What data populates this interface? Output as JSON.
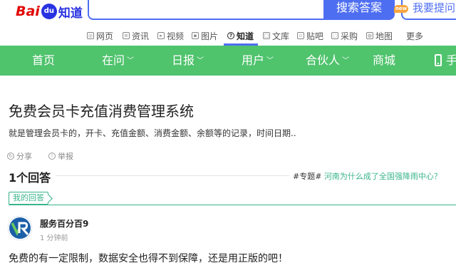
{
  "header": {
    "logo_bai": "Bai",
    "logo_du": "du",
    "logo_zhidao": "知道",
    "search_value": "",
    "search_button": "搜索答案",
    "ask_button": "我要提问"
  },
  "channels": [
    {
      "label": "网页",
      "icon": "web-icon"
    },
    {
      "label": "资讯",
      "icon": "news-icon"
    },
    {
      "label": "视频",
      "icon": "video-icon"
    },
    {
      "label": "图片",
      "icon": "image-icon"
    },
    {
      "label": "知道",
      "icon": "question-icon",
      "active": true
    },
    {
      "label": "文库",
      "icon": "doc-icon"
    },
    {
      "label": "贴吧",
      "icon": "tieba-icon"
    },
    {
      "label": "采购",
      "icon": "purchase-icon"
    },
    {
      "label": "地图",
      "icon": "map-icon"
    },
    {
      "label": "更多",
      "icon": ""
    }
  ],
  "nav": {
    "items": [
      {
        "label": "首页"
      },
      {
        "label": "在问"
      },
      {
        "label": "日报"
      },
      {
        "label": "用户"
      },
      {
        "label": "合伙人"
      },
      {
        "label": "商城"
      }
    ],
    "new_badge": "new",
    "phone_text": "手"
  },
  "question": {
    "title": "免费会员卡充值消费管理系统",
    "description": "就是管理会员卡的，开卡、充值金额、消费金额、余额等的记录，时间日期..",
    "share": "分享",
    "report": "举报"
  },
  "answers": {
    "count_label": "1个回答",
    "topic_tag": "#专题#",
    "topic_link": "河南为什么成了全国强降雨中心？",
    "my_answer_tab": "我的回答"
  },
  "answer": {
    "author": "服务百分百9",
    "time": "1 分钟前",
    "text": "免费的有一定限制，数据安全也得不到保障，还是用正版的吧！"
  },
  "colors": {
    "nav_green": "#50c36d",
    "baidu_blue": "#4e6ef2",
    "link_green": "#38b48b"
  }
}
